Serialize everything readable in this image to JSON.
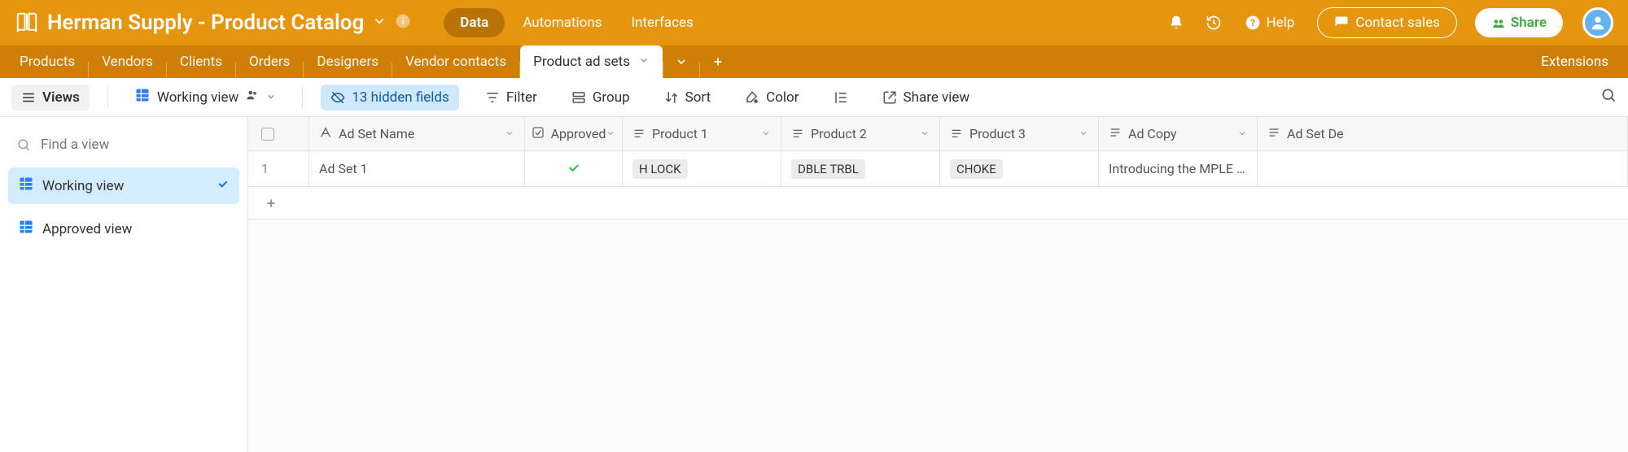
{
  "header": {
    "base_title": "Herman Supply - Product Catalog",
    "nav": {
      "data": "Data",
      "automations": "Automations",
      "interfaces": "Interfaces"
    },
    "help": "Help",
    "contact_sales": "Contact sales",
    "share": "Share"
  },
  "tabs": {
    "items": [
      "Products",
      "Vendors",
      "Clients",
      "Orders",
      "Designers",
      "Vendor contacts"
    ],
    "active": "Product ad sets",
    "extensions": "Extensions"
  },
  "toolbar": {
    "views": "Views",
    "working_view": "Working view",
    "hidden_fields": "13 hidden fields",
    "filter": "Filter",
    "group": "Group",
    "sort": "Sort",
    "color": "Color",
    "share_view": "Share view"
  },
  "sidebar": {
    "find_placeholder": "Find a view",
    "views": [
      {
        "label": "Working view",
        "active": true,
        "checked": true
      },
      {
        "label": "Approved view",
        "active": false,
        "checked": false
      }
    ]
  },
  "grid": {
    "columns": {
      "name": "Ad Set Name",
      "approved": "Approved",
      "product1": "Product 1",
      "product2": "Product 2",
      "product3": "Product 3",
      "adcopy": "Ad Copy",
      "adsetde": "Ad Set De"
    },
    "rows": [
      {
        "num": "1",
        "name": "Ad Set 1",
        "approved": true,
        "product1": "H LOCK",
        "product2": "DBLE TRBL",
        "product3": "CHOKE",
        "adcopy": "Introducing the MPLE Col..."
      }
    ]
  }
}
